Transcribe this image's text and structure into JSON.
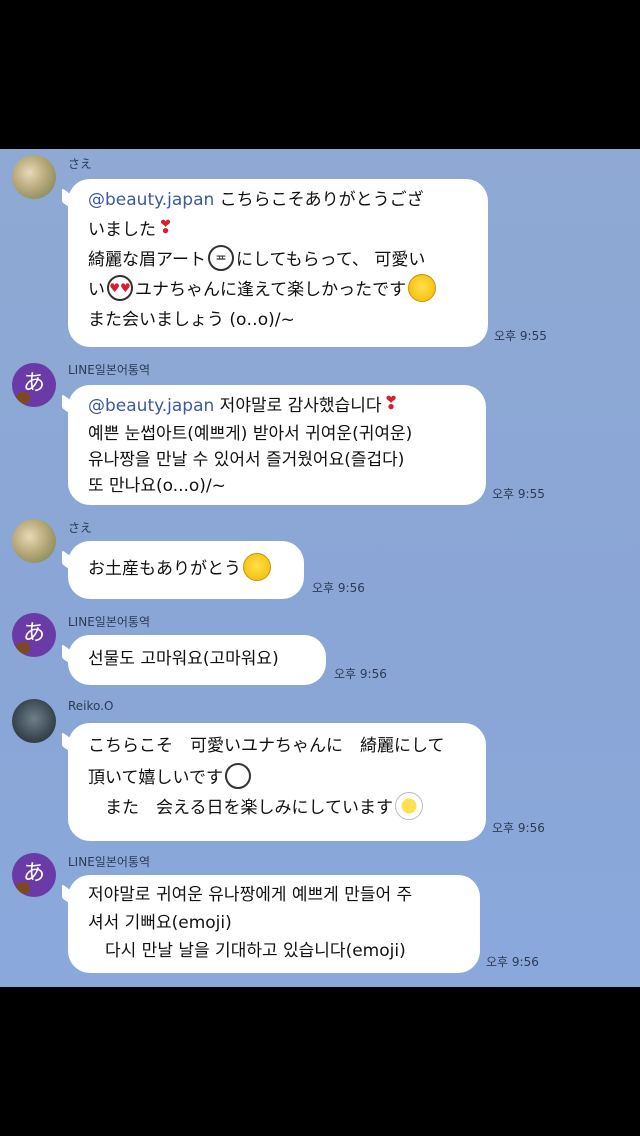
{
  "messages": [
    {
      "sender": "さえ",
      "avatar": "sae-photo",
      "lines": [
        "@beauty.japan",
        " こちらこそありがとうござ",
        "いました",
        "綺麗な眉アート",
        "にしてもらって、 可愛い",
        "い",
        "ユナちゃんに逢えて楽しかったです",
        "また会いましょう (o‥o)/~"
      ],
      "time": "오후 9:55"
    },
    {
      "sender": "LINE일본어통역",
      "avatar_char": "あ",
      "lines": [
        "@beauty.japan",
        " 저야말로 감사했습니다",
        "예쁜 눈썹아트(예쁘게) 받아서 귀여운(귀여운)",
        "유나짱을 만날 수 있어서 즐거웠어요(즐겁다)",
        "또 만나요(o...o)/~"
      ],
      "time": "오후 9:55"
    },
    {
      "sender": "さえ",
      "avatar": "sae-photo",
      "lines": [
        "お土産もありがとう"
      ],
      "time": "오후 9:56"
    },
    {
      "sender": "LINE일본어통역",
      "avatar_char": "あ",
      "lines": [
        "선물도 고마워요(고마워요)"
      ],
      "time": "오후 9:56"
    },
    {
      "sender": "Reiko.O",
      "avatar": "reiko-photo",
      "lines": [
        "こちらこそ　可愛いユナちゃんに　綺麗にして",
        "頂いて嬉しいです",
        "　また　会える日を楽しみにしています"
      ],
      "time": "오후 9:56"
    },
    {
      "sender": "LINE일본어통역",
      "avatar_char": "あ",
      "lines": [
        "저야말로 귀여운 유나짱에게 예쁘게 만들어 주",
        "셔서 기뻐요(emoji)",
        "　다시 만날 날을 기대하고 있습니다(emoji)"
      ],
      "time": "오후 9:56"
    }
  ],
  "colors": {
    "chat_bg": "#8aa6d6",
    "bubble": "#ffffff",
    "mention": "#3b5b9d",
    "line_avatar": "#6a3aa6"
  }
}
